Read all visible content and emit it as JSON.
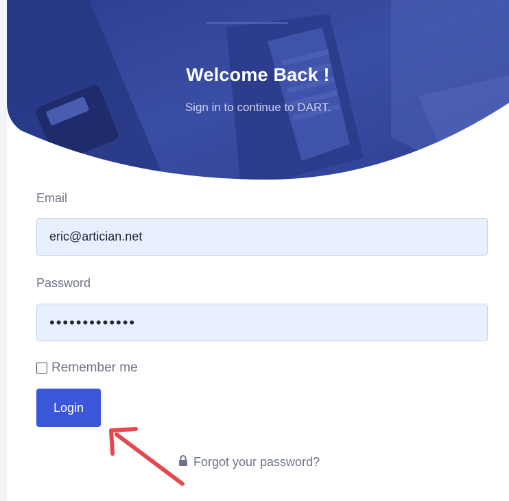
{
  "hero": {
    "title": "Welcome Back !",
    "subtitle": "Sign in to continue to DART."
  },
  "form": {
    "email_label": "Email",
    "email_value": "eric@artician.net",
    "password_label": "Password",
    "password_value": "•••••••••••••",
    "remember_label": "Remember me",
    "remember_checked": false,
    "login_label": "Login",
    "forgot_label": "Forgot your password?"
  },
  "icons": {
    "forgot": "lock-icon",
    "annotation": "red-arrow-icon"
  },
  "colors": {
    "primary": "#3b56d8",
    "hero_overlay": "#33469c",
    "input_bg": "#e8f0fe",
    "label": "#6d7386",
    "annotation": "#e8474f"
  }
}
